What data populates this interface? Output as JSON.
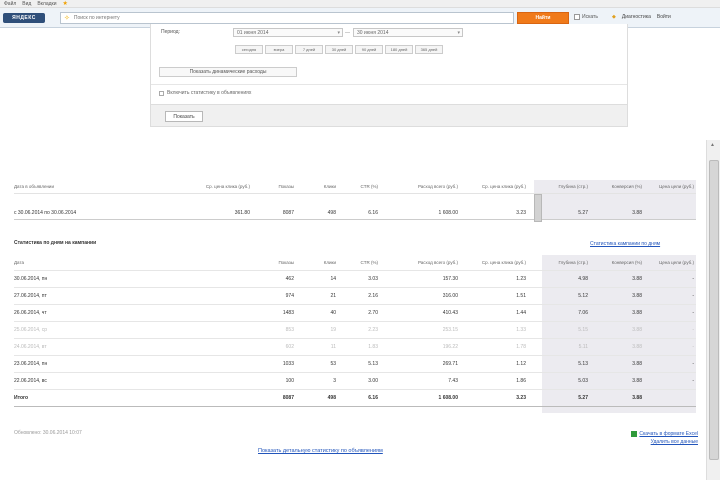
{
  "menubar": {
    "items": [
      "Файл",
      "Вид",
      "Вкладки"
    ],
    "star_icon": "star-icon"
  },
  "toolbar": {
    "logo": "ЯНДЕКС",
    "search_placeholder": "Поиск по интернету",
    "search_button": "Найти",
    "checkbox_label": "Искать",
    "links": [
      "Диагностика",
      "Войти"
    ]
  },
  "filter": {
    "period_label": "Период:",
    "date_from": "01 июня 2014",
    "date_to": "30 июня 2014",
    "presets": [
      "сегодня",
      "вчера",
      "7 дней",
      "30 дней",
      "90 дней",
      "180 дней",
      "365 дней"
    ],
    "dynamics_button": "Показать динамические расходы",
    "checkbox_label": "Включить статистику в объявлениях",
    "apply_button": "Показать"
  },
  "summary": {
    "headers": [
      "Дата в объявлении",
      "Ср. цена клика (руб.)",
      "Показы",
      "Клики",
      "CTR (%)",
      "Расход всего (руб.)",
      "Ср. цена клика (руб.)",
      "Глубина (стр.)",
      "Конверсия (%)",
      "Цена цели (руб.)"
    ],
    "row": [
      "с 30.06.2014 по 30.06.2014",
      "361.80",
      "8087",
      "498",
      "6.16",
      "1 608.00",
      "3.23",
      "5.27",
      "3.88",
      ""
    ]
  },
  "daily": {
    "title": "Статистика по дням на кампании",
    "link": "Статистика кампании по дням",
    "headers": [
      "Дата",
      "Показы",
      "Клики",
      "CTR (%)",
      "Расход всего (руб.)",
      "Ср. цена клика (руб.)",
      "Глубина (стр.)",
      "Конверсия (%)",
      "Цена цели (руб.)"
    ],
    "rows": [
      {
        "date": "30.06.2014, пн",
        "vals": [
          "462",
          "14",
          "3.03",
          "157.30",
          "1.23",
          "4.98",
          "3.88",
          "-"
        ],
        "faded": false
      },
      {
        "date": "27.06.2014, пт",
        "vals": [
          "974",
          "21",
          "2.16",
          "316.00",
          "1.51",
          "5.12",
          "3.88",
          "-"
        ],
        "faded": false
      },
      {
        "date": "26.06.2014, чт",
        "vals": [
          "1483",
          "40",
          "2.70",
          "410.43",
          "1.44",
          "7.06",
          "3.88",
          "-"
        ],
        "faded": false
      },
      {
        "date": "25.06.2014, ср",
        "vals": [
          "853",
          "19",
          "2.23",
          "253.15",
          "1.33",
          "5.15",
          "3.88",
          "-"
        ],
        "faded": true
      },
      {
        "date": "24.06.2014, вт",
        "vals": [
          "602",
          "11",
          "1.83",
          "196.22",
          "1.78",
          "5.11",
          "3.88",
          "-"
        ],
        "faded": true
      },
      {
        "date": "23.06.2014, пн",
        "vals": [
          "1033",
          "53",
          "5.13",
          "269.71",
          "1.12",
          "5.13",
          "3.88",
          "-"
        ],
        "faded": false
      },
      {
        "date": "22.06.2014, вс",
        "vals": [
          "100",
          "3",
          "3.00",
          "7.43",
          "1.86",
          "5.03",
          "3.88",
          "-"
        ],
        "faded": false
      }
    ],
    "total": {
      "date": "Итого",
      "vals": [
        "8087",
        "498",
        "6.16",
        "1 608.00",
        "3.23",
        "5.27",
        "3.88",
        ""
      ]
    }
  },
  "footer": {
    "updated": "Обновлено: 30.06.2014 10:07",
    "links": [
      "Скачать в формате Excel",
      "Удалить все данные"
    ],
    "bottom_link": "Показать детальную статистику по объявлениям"
  }
}
